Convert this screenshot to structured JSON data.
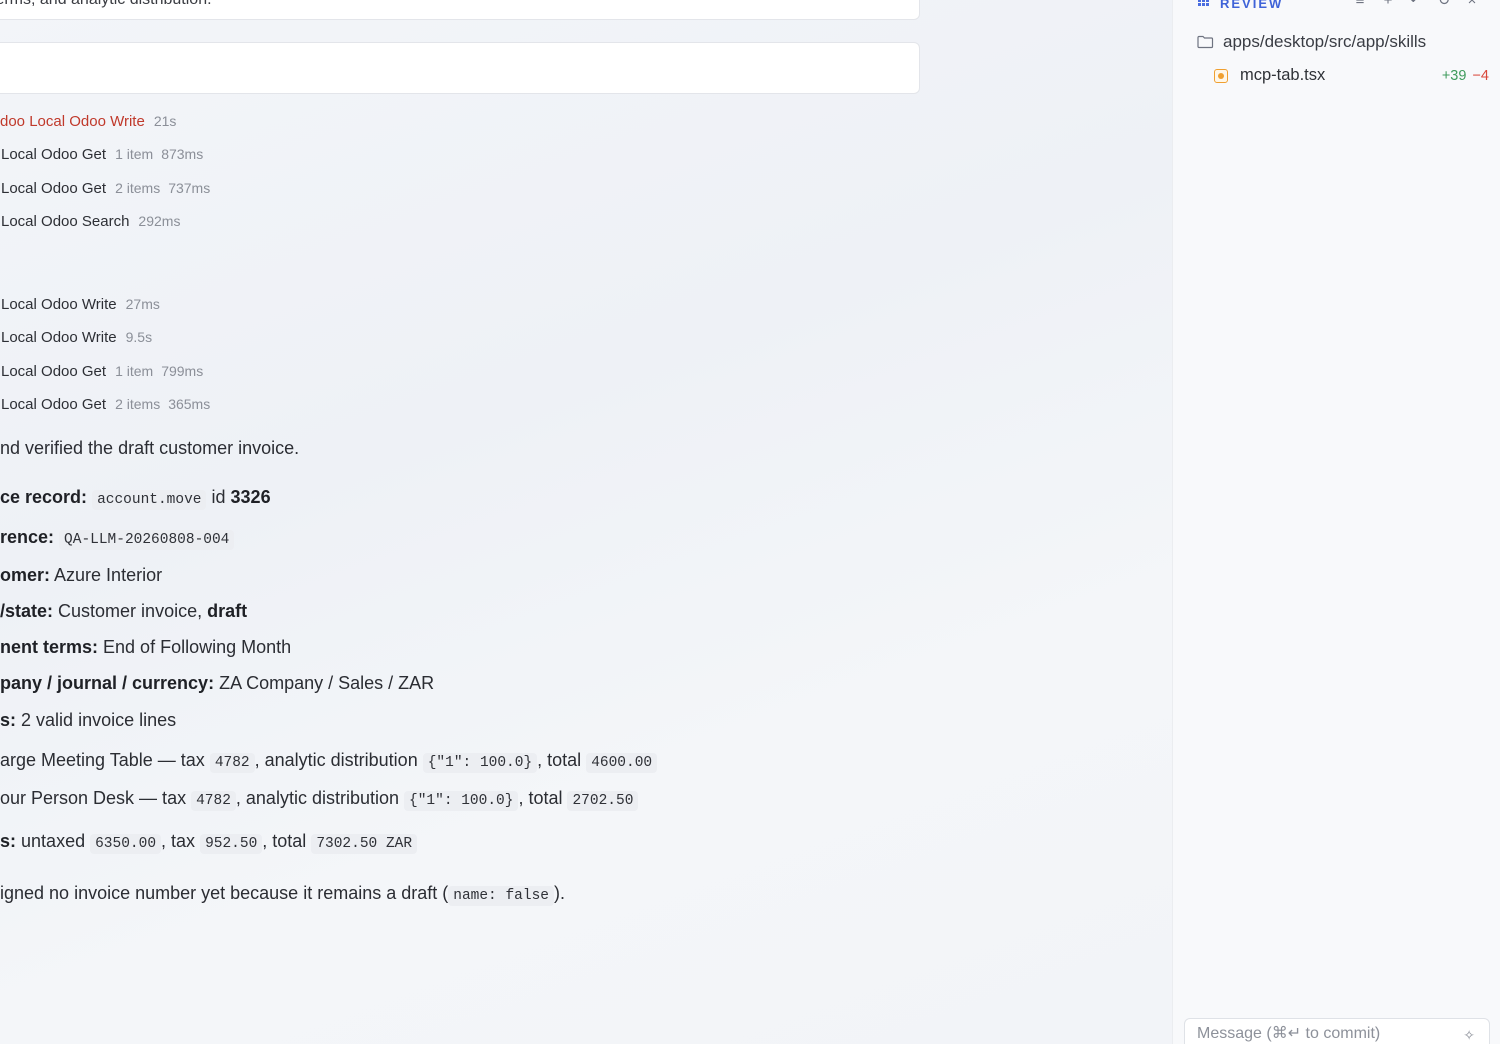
{
  "chat": {
    "prev_message_tail": "terms, and analytic distribution.",
    "tool_calls": [
      {
        "name": "doo Local Odoo Write",
        "meta": [
          "21s"
        ],
        "error": true
      },
      {
        "name": "Local Odoo Get",
        "meta": [
          "1 item",
          "873ms"
        ],
        "error": false
      },
      {
        "name": "Local Odoo Get",
        "meta": [
          "2 items",
          "737ms"
        ],
        "error": false
      },
      {
        "name": "Local Odoo Search",
        "meta": [
          "292ms"
        ],
        "error": false
      },
      {
        "name": "Local Odoo Write",
        "meta": [
          "27ms"
        ],
        "error": false
      },
      {
        "name": "Local Odoo Write",
        "meta": [
          "9.5s"
        ],
        "error": false
      },
      {
        "name": "Local Odoo Get",
        "meta": [
          "1 item",
          "799ms"
        ],
        "error": false
      },
      {
        "name": "Local Odoo Get",
        "meta": [
          "2 items",
          "365ms"
        ],
        "error": false
      }
    ],
    "summary": {
      "intro": "nd verified the draft customer invoice.",
      "record_label": "ce record:",
      "record_model": "account.move",
      "record_id_text": "id",
      "record_id": "3326",
      "reference_label": "rence:",
      "reference_value": "QA-LLM-20260808-004",
      "customer_label": "omer:",
      "customer_value": "Azure Interior",
      "state_label": "/state:",
      "state_value": "Customer invoice,",
      "state_bold": "draft",
      "terms_label": "nent terms:",
      "terms_value": "End of Following Month",
      "company_label": "pany / journal / currency:",
      "company_value": "ZA Company / Sales / ZAR",
      "lines_label": "s:",
      "lines_value": "2 valid invoice lines",
      "line1": {
        "prefix": "arge Meeting Table — tax",
        "tax": "4782",
        "mid": ", analytic distribution",
        "analytic": "{\"1\": 100.0}",
        "total_label": ", total",
        "total": "4600.00"
      },
      "line2": {
        "prefix": "our Person Desk — tax",
        "tax": "4782",
        "mid": ", analytic distribution",
        "analytic": "{\"1\": 100.0}",
        "total_label": ", total",
        "total": "2702.50"
      },
      "totals_label": "s:",
      "totals_untaxed_text": "untaxed",
      "totals_untaxed": "6350.00",
      "totals_tax_text": ", tax",
      "totals_tax": "952.50",
      "totals_total_text": ", total",
      "totals_total": "7302.50 ZAR",
      "footer_text": "igned no invoice number yet because it remains a draft (",
      "footer_code": "name: false",
      "footer_end": ")."
    }
  },
  "panel": {
    "title": "REVIEW",
    "folder_path": "apps/desktop/src/app/skills",
    "file": {
      "name": "mcp-tab.tsx",
      "additions": "+39",
      "deletions": "−4"
    },
    "commit_placeholder": "Message (⌘↵ to commit)"
  },
  "colors": {
    "accent": "#3f63d8",
    "error": "#c0392b",
    "added": "#3f9b5c",
    "deleted": "#d9483b",
    "modified": "#f0a030"
  }
}
